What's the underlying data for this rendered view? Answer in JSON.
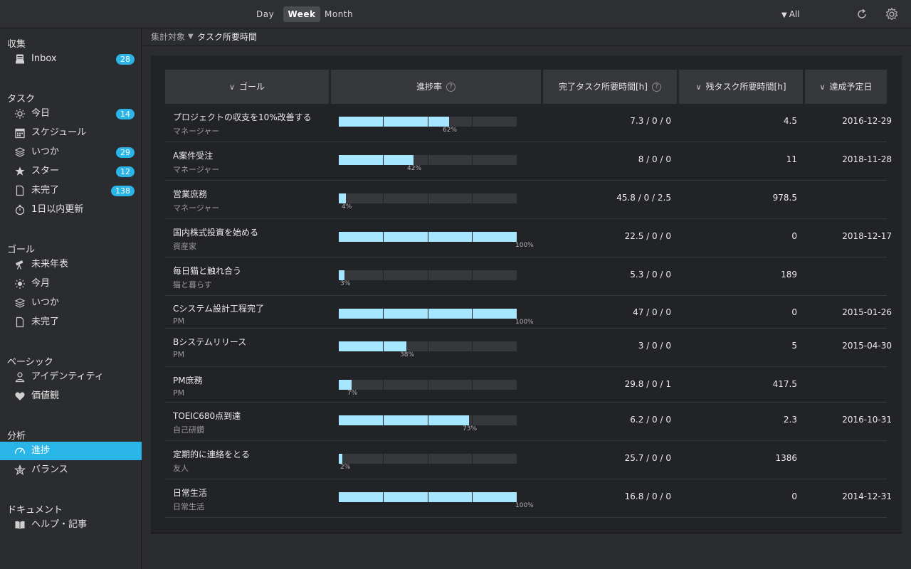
{
  "topbar": {
    "views": [
      "Day",
      "Week",
      "Month"
    ],
    "active_view": "Week",
    "filter_label": "All",
    "icons": [
      "refresh-icon",
      "gear-icon"
    ]
  },
  "sidebar": {
    "sections": [
      {
        "title": "収集",
        "items": [
          {
            "label": "Inbox",
            "icon": "inbox-icon",
            "badge": "28"
          }
        ]
      },
      {
        "title": "タスク",
        "items": [
          {
            "label": "今日",
            "icon": "sun-icon",
            "badge": "14"
          },
          {
            "label": "スケジュール",
            "icon": "calendar-icon",
            "badge": ""
          },
          {
            "label": "いつか",
            "icon": "layers-icon",
            "badge": "29"
          },
          {
            "label": "スター",
            "icon": "star-icon",
            "badge": "12"
          },
          {
            "label": "未完了",
            "icon": "document-icon",
            "badge": "138"
          },
          {
            "label": "1日以内更新",
            "icon": "stopwatch-icon",
            "badge": ""
          }
        ]
      },
      {
        "title": "ゴール",
        "items": [
          {
            "label": "未来年表",
            "icon": "telescope-icon",
            "badge": ""
          },
          {
            "label": "今月",
            "icon": "sun-icon",
            "badge": ""
          },
          {
            "label": "いつか",
            "icon": "layers-icon",
            "badge": ""
          },
          {
            "label": "未完了",
            "icon": "document-icon",
            "badge": ""
          }
        ]
      },
      {
        "title": "ベーシック",
        "items": [
          {
            "label": "アイデンティティ",
            "icon": "person-icon",
            "badge": ""
          },
          {
            "label": "価値観",
            "icon": "heart-icon",
            "badge": ""
          }
        ]
      },
      {
        "title": "分析",
        "items": [
          {
            "label": "進捗",
            "icon": "gauge-icon",
            "badge": "",
            "active": true
          },
          {
            "label": "バランス",
            "icon": "star-outline-icon",
            "badge": ""
          }
        ]
      },
      {
        "title": "ドキュメント",
        "items": [
          {
            "label": "ヘルプ・記事",
            "icon": "book-icon",
            "badge": ""
          }
        ]
      }
    ]
  },
  "breadcrumb": {
    "parent": "集計対象",
    "current": "タスク所要時間"
  },
  "table": {
    "headers": [
      "ゴール",
      "進捗率",
      "完了タスク所要時間[h]",
      "残タスク所要時間[h]",
      "達成予定日"
    ],
    "rows": [
      {
        "goal": "プロジェクトの収支を10%改善する",
        "category": "マネージャー",
        "progress": 62,
        "pct_label": "62%",
        "done": "7.3 / 0 / 0",
        "remaining": "4.5",
        "due": "2016-12-29"
      },
      {
        "goal": "A案件受注",
        "category": "マネージャー",
        "progress": 42,
        "pct_label": "42%",
        "done": "8 / 0 / 0",
        "remaining": "11",
        "due": "2018-11-28"
      },
      {
        "goal": "営業庶務",
        "category": "マネージャー",
        "progress": 4,
        "pct_label": "4%",
        "done": "45.8 / 0 / 2.5",
        "remaining": "978.5",
        "due": ""
      },
      {
        "goal": "国内株式投資を始める",
        "category": "資産家",
        "progress": 100,
        "pct_label": "100%",
        "done": "22.5 / 0 / 0",
        "remaining": "0",
        "due": "2018-12-17"
      },
      {
        "goal": "毎日猫と触れ合う",
        "category": "猫と暮らす",
        "progress": 3,
        "pct_label": "3%",
        "done": "5.3 / 0 / 0",
        "remaining": "189",
        "due": ""
      },
      {
        "goal": "Cシステム設計工程完了",
        "category": "PM",
        "progress": 100,
        "pct_label": "100%",
        "done": "47 / 0 / 0",
        "remaining": "0",
        "due": "2015-01-26"
      },
      {
        "goal": "Bシステムリリース",
        "category": "PM",
        "progress": 38,
        "pct_label": "38%",
        "done": "3 / 0 / 0",
        "remaining": "5",
        "due": "2015-04-30"
      },
      {
        "goal": "PM庶務",
        "category": "PM",
        "progress": 7,
        "pct_label": "7%",
        "done": "29.8 / 0 / 1",
        "remaining": "417.5",
        "due": ""
      },
      {
        "goal": "TOEIC680点到達",
        "category": "自己研鑽",
        "progress": 73,
        "pct_label": "73%",
        "done": "6.2 / 0 / 0",
        "remaining": "2.3",
        "due": "2016-10-31"
      },
      {
        "goal": "定期的に連絡をとる",
        "category": "友人",
        "progress": 2,
        "pct_label": "2%",
        "done": "25.7 / 0 / 0",
        "remaining": "1386",
        "due": ""
      },
      {
        "goal": "日常生活",
        "category": "日常生活",
        "progress": 100,
        "pct_label": "100%",
        "done": "16.8 / 0 / 0",
        "remaining": "0",
        "due": "2014-12-31"
      }
    ]
  },
  "colors": {
    "accent": "#2ab5e8",
    "bar_fill": "#a7e6ff",
    "bar_track": "#37383b"
  }
}
